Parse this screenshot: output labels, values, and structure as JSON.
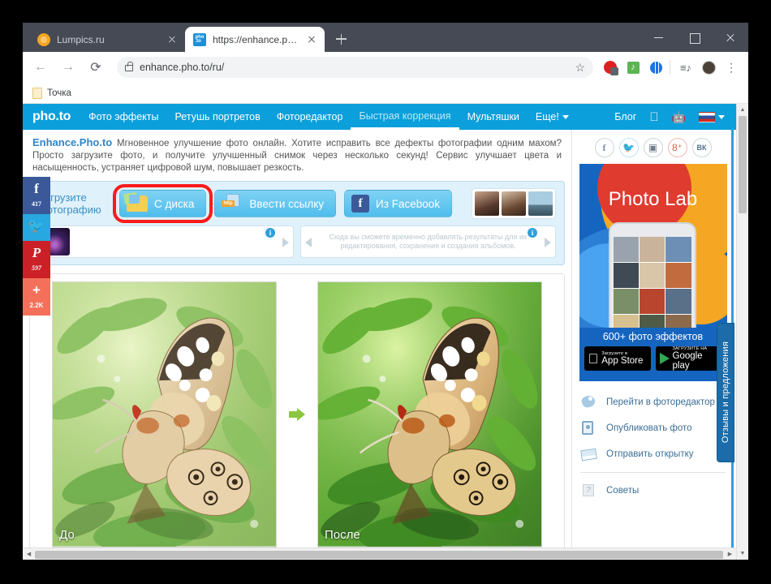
{
  "browser": {
    "tabs": [
      {
        "title": "Lumpics.ru",
        "favicon": "orange-circle-icon",
        "active": false
      },
      {
        "title": "https://enhance.pho.to/ru/",
        "favicon": "photo-logo-icon",
        "active": true
      }
    ],
    "new_tab_label": "+",
    "window_controls": {
      "minimize": "minimize-icon",
      "maximize": "maximize-icon",
      "close": "close-icon"
    },
    "nav": {
      "back": "←",
      "forward": "→",
      "reload": "⟳"
    },
    "omnibox": {
      "url": "enhance.pho.to/ru/",
      "lock": "lock-icon",
      "star": "☆"
    },
    "extensions": [
      "adblock-icon",
      "music-icon",
      "globe-icon",
      "reading-list-icon",
      "avatar-icon",
      "chrome-menu-icon"
    ],
    "bookmarks": [
      {
        "label": "Точка"
      }
    ]
  },
  "site": {
    "brand": "pho.to",
    "nav_items": [
      {
        "label": "Фото эффекты",
        "active": false
      },
      {
        "label": "Ретушь портретов",
        "active": false
      },
      {
        "label": "Фоторедактор",
        "active": false
      },
      {
        "label": "Быстрая коррекция",
        "active": true
      },
      {
        "label": "Мультяшки",
        "active": false
      },
      {
        "label": "Еще!",
        "active": false
      }
    ],
    "nav_right": {
      "blog": "Блог",
      "apple": "apple-icon",
      "android": "android-icon",
      "flag": "russian-flag-icon"
    },
    "intro": {
      "brand": "Enhance.Pho.to",
      "text": "Мгновенное улучшение фото онлайн. Хотите исправить все дефекты фотографии одним махом? Просто загрузите фото, и получите улучшенный снимок через несколько секунд! Сервис улучшает цвета и насыщенность, устраняет цифровой шум, повышает резкость."
    },
    "upload": {
      "label": "Загрузите фотографию",
      "from_disk": "С диска",
      "from_link": "Ввести ссылку",
      "from_facebook": "Из Facebook",
      "highlighted": "from-disk"
    },
    "strips": {
      "right_hint": "Сюда вы сможете временно добавлять результаты для их редактирования, сохранения и создания альбомов.",
      "info": "i"
    },
    "compare": {
      "before": "До",
      "after": "После",
      "arrow": "arrow-right-icon"
    },
    "social_rail": [
      {
        "name": "facebook",
        "glyph": "f",
        "count": "417",
        "color": "#3b5998"
      },
      {
        "name": "twitter",
        "glyph": "🐦",
        "count": "",
        "color": "#27a8e0"
      },
      {
        "name": "pinterest",
        "glyph": "P",
        "count": "597",
        "color": "#cb2027"
      },
      {
        "name": "share",
        "glyph": "+",
        "count": "2.2K",
        "color": "#f4705a"
      }
    ]
  },
  "sidebar": {
    "social": [
      {
        "name": "facebook-icon",
        "glyph": "f"
      },
      {
        "name": "twitter-icon",
        "glyph": "🐦"
      },
      {
        "name": "instagram-icon",
        "glyph": "▣"
      },
      {
        "name": "google-plus-icon",
        "glyph": "8⁺"
      },
      {
        "name": "vk-icon",
        "glyph": "ВК"
      }
    ],
    "ad": {
      "title": "Photo Lab",
      "subtitle": "600+ фото эффектов",
      "appstore_small": "Загрузите в",
      "appstore_big": "App Store",
      "play_small": "ЗАГРУЗИТЕ НА",
      "play_big": "Google play"
    },
    "menu": [
      {
        "label": "Перейти в фоторедактор",
        "icon": "brush-icon"
      },
      {
        "label": "Опубликовать фото",
        "icon": "portrait-icon"
      },
      {
        "label": "Отправить открытку",
        "icon": "envelope-icon"
      },
      {
        "label": "Советы",
        "icon": "help-icon"
      }
    ],
    "feedback_tab": "Отзывы и предложения"
  },
  "colors": {
    "site_blue": "#0b9fdb",
    "highlight_red": "#ff1a1a",
    "panel_blue": "#dff1fb",
    "ad_blue": "#1565c0"
  }
}
